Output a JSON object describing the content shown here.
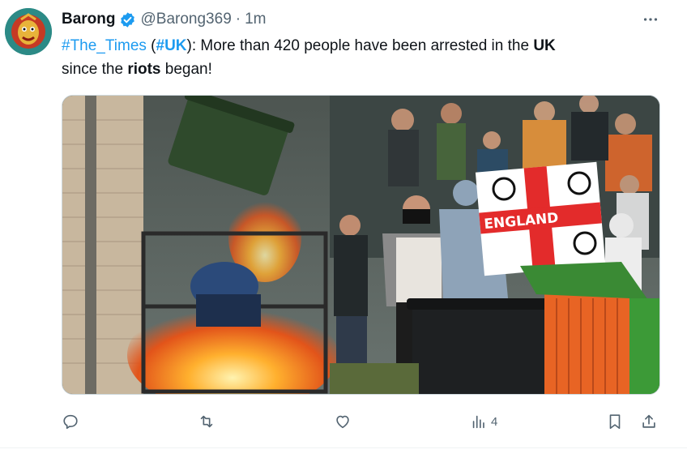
{
  "author": {
    "name": "Barong",
    "handle": "@Barong369",
    "separator": "·",
    "time": "1m",
    "avatar_icon": "barong-mask-avatar",
    "verified_color": "#1d9bf0"
  },
  "tweet": {
    "hashtag1": "#The_Times",
    "open_paren": " (",
    "hashtag2": "#UK",
    "segment1": "): More than 420 people have been arrested in the ",
    "bold1": "UK",
    "segment2": " since the ",
    "bold2": "riots",
    "segment3": " began!",
    "flag_text": "ENGLAND"
  },
  "actions": {
    "reply_icon": "reply-icon",
    "retweet_icon": "retweet-icon",
    "like_icon": "heart-icon",
    "views_icon": "views-icon",
    "views_count": "4",
    "bookmark_icon": "bookmark-icon",
    "share_icon": "share-icon"
  },
  "colors": {
    "link": "#1d9bf0",
    "muted": "#536471",
    "text": "#0f1419"
  }
}
